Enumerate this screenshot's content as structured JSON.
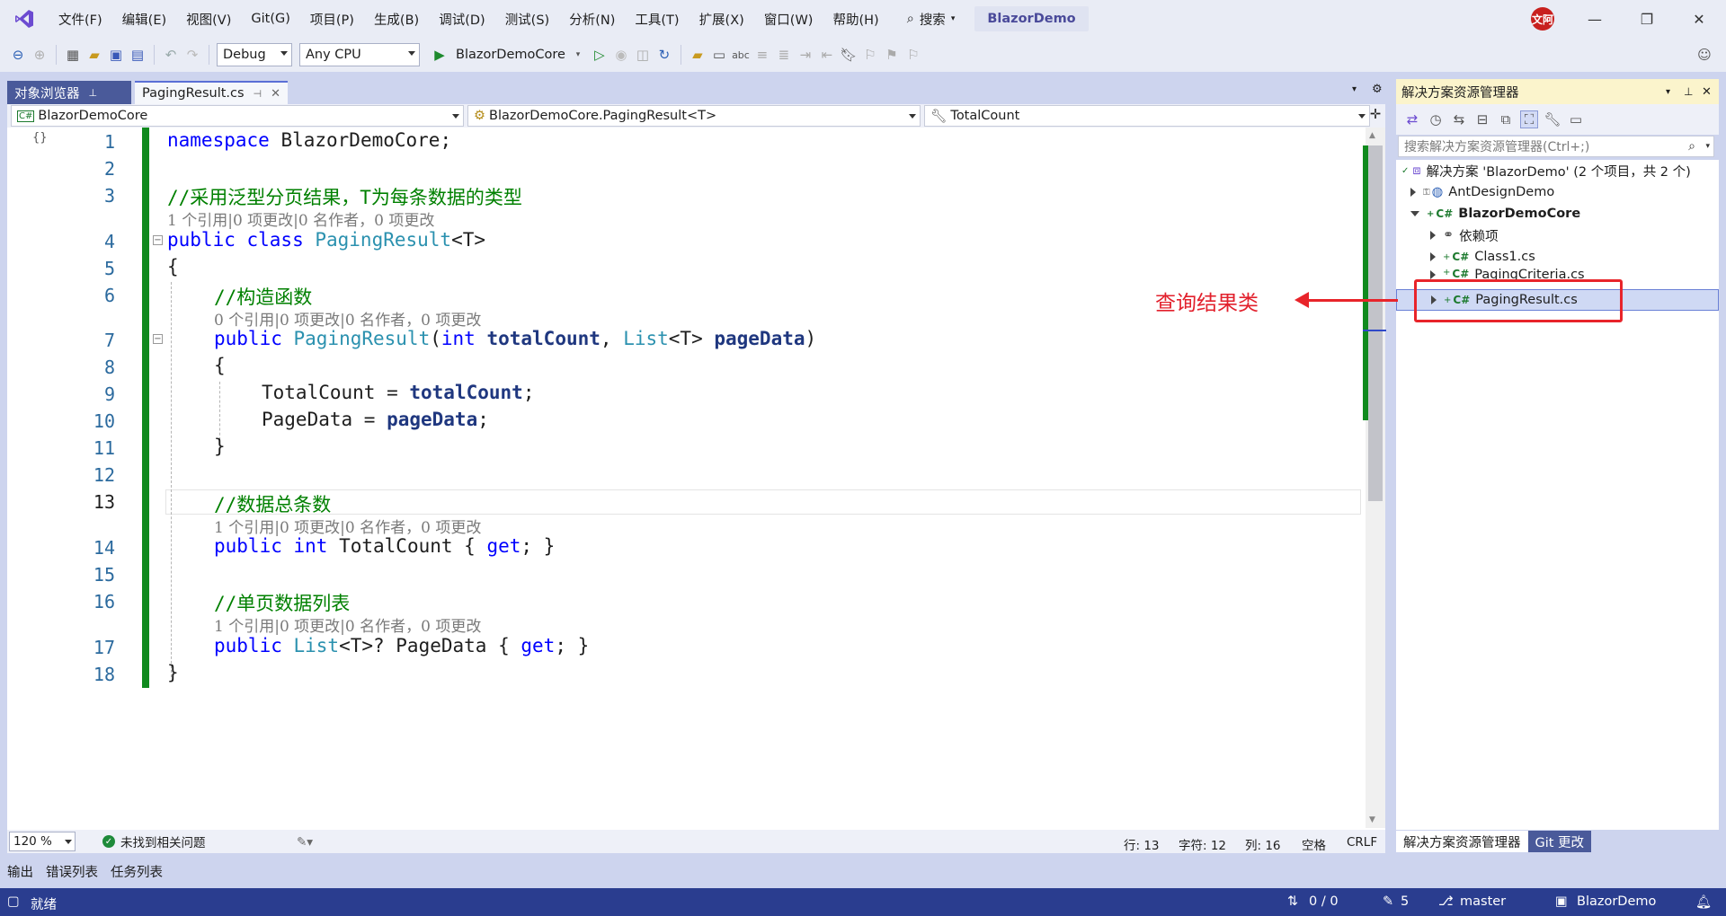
{
  "titlebar": {
    "menus": [
      "文件(F)",
      "编辑(E)",
      "视图(V)",
      "Git(G)",
      "项目(P)",
      "生成(B)",
      "调试(D)",
      "测试(S)",
      "分析(N)",
      "工具(T)",
      "扩展(X)",
      "窗口(W)",
      "帮助(H)"
    ],
    "search_label": "搜索",
    "solution_name": "BlazorDemo",
    "avatar_text": "文阿"
  },
  "toolbar": {
    "config": "Debug",
    "platform": "Any CPU",
    "run_target": "BlazorDemoCore"
  },
  "doc_tabs": {
    "object_browser": "对象浏览器",
    "active_file": "PagingResult.cs"
  },
  "navbar": {
    "project": "BlazorDemoCore",
    "type": "BlazorDemoCore.PagingResult<T>",
    "member": "TotalCount"
  },
  "editor": {
    "line_numbers": [
      "1",
      "2",
      "3",
      "4",
      "5",
      "6",
      "7",
      "8",
      "9",
      "10",
      "11",
      "12",
      "13",
      "14",
      "15",
      "16",
      "17",
      "18"
    ],
    "current_line": "13",
    "code": {
      "l1_kw": "namespace",
      "l1_rest": " BlazorDemoCore;",
      "l3": "//采用泛型分页结果，T为每条数据的类型",
      "lens_class": "1 个引用|0 项更改|0 名作者，0 项更改",
      "l4_kw": "public class",
      "l4_type": " PagingResult",
      "l4_rest": "<T>",
      "l5": "{",
      "l6": "//构造函数",
      "lens_ctor": "0 个引用|0 项更改|0 名作者，0 项更改",
      "l7_kw": "public",
      "l7_type": " PagingResult",
      "l7_a": "(",
      "l7_int": "int",
      "l7_p1": " totalCount",
      "l7_b": ", ",
      "l7_list": "List",
      "l7_c": "<T> ",
      "l7_p2": "pageData",
      "l7_d": ")",
      "l8": "{",
      "l9_a": "TotalCount = ",
      "l9_p": "totalCount",
      "l9_b": ";",
      "l10_a": "PageData = ",
      "l10_p": "pageData",
      "l10_b": ";",
      "l11": "}",
      "l13": "//数据总条数",
      "lens_total": "1 个引用|0 项更改|0 名作者，0 项更改",
      "l14_kw": "public int",
      "l14_a": " TotalCount { ",
      "l14_get": "get",
      "l14_b": "; }",
      "l16": "//单页数据列表",
      "lens_page": "1 个引用|0 项更改|0 名作者，0 项更改",
      "l17_kw": "public",
      "l17_list": " List",
      "l17_a": "<T>? PageData { ",
      "l17_get": "get",
      "l17_b": "; }",
      "l18": "}"
    }
  },
  "editor_status": {
    "zoom": "120 %",
    "issues": "未找到相关问题",
    "line": "行: 13",
    "char": "字符: 12",
    "col": "列: 16",
    "whitespace": "空格",
    "eol": "CRLF"
  },
  "solution_explorer": {
    "title": "解决方案资源管理器",
    "search_placeholder": "搜索解决方案资源管理器(Ctrl+;)",
    "solution": "解决方案 'BlazorDemo' (2 个项目，共 2 个)",
    "items": [
      "AntDesignDemo",
      "BlazorDemoCore",
      "依赖项",
      "Class1.cs",
      "PagingCriteria.cs",
      "PagingResult.cs"
    ],
    "tab_se": "解决方案资源管理器",
    "tab_git": "Git 更改"
  },
  "bottom_tabs": [
    "输出",
    "错误列表",
    "任务列表"
  ],
  "statusbar": {
    "ready": "就绪",
    "sync": "0 / 0",
    "edits": "5",
    "branch": "master",
    "repo": "BlazorDemo"
  },
  "annotation": {
    "text": "查询结果类"
  },
  "colors": {
    "accent": "#2a3d8f",
    "change_bar": "#108a1e",
    "annotation": "#e8242a"
  }
}
